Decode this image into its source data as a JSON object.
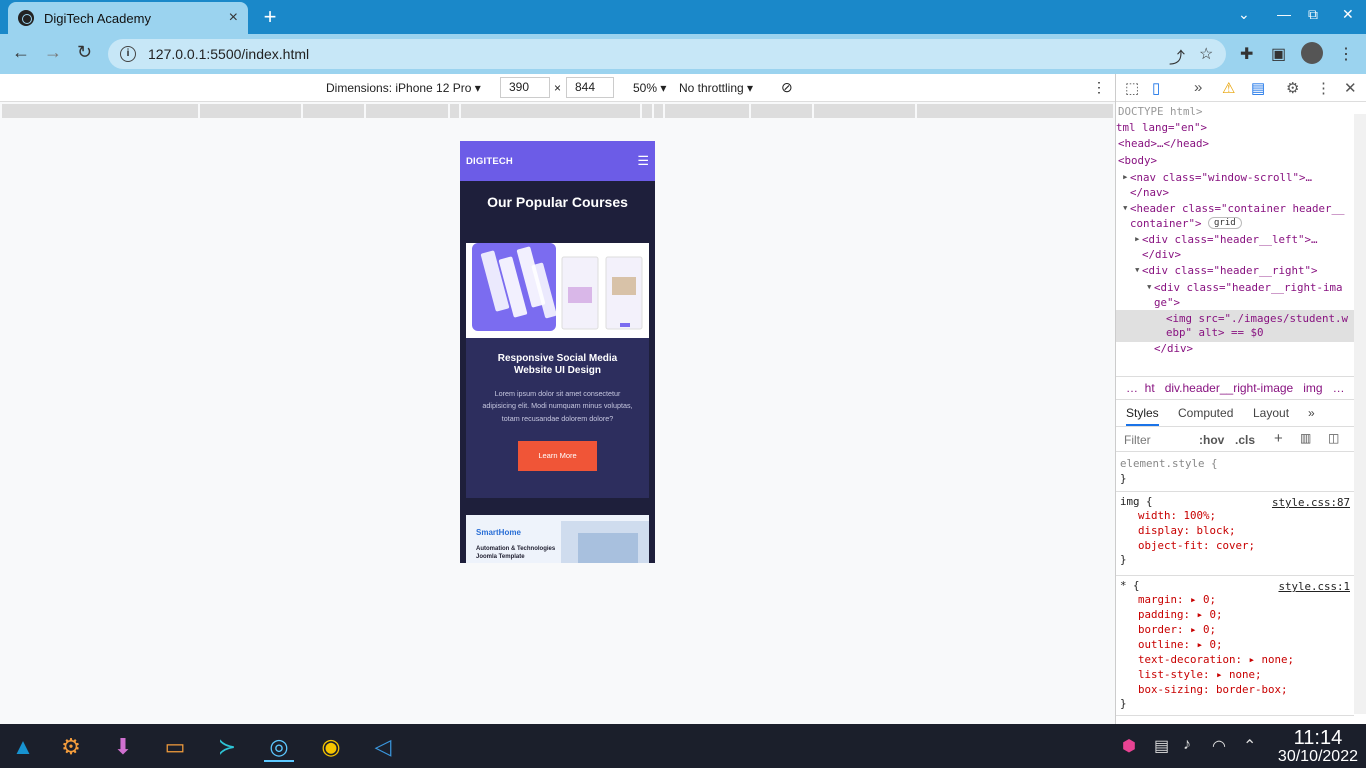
{
  "browser": {
    "tab_title": "DigiTech Academy",
    "url": "127.0.0.1:5500/index.html",
    "new_tab": "+",
    "close_tab": "×"
  },
  "device_toolbar": {
    "dimensions_label": "Dimensions: iPhone 12 Pro ▾",
    "width": "390",
    "times": "×",
    "height": "844",
    "zoom": "50% ▾",
    "throttling": "No throttling ▾"
  },
  "site": {
    "logo": "DIGITECH",
    "heading": "Our Popular Courses",
    "card1": {
      "title": "Responsive Social Media Website UI Design",
      "text": "Lorem ipsum dolor sit amet consectetur adipisicing elit. Modi numquam minus voluptas, totam recusandae dolorem dolore?",
      "button": "Learn More"
    },
    "card2": {
      "brand": "SmartHome",
      "subtitle": "Automation & Technologies Joomla Template"
    }
  },
  "devtools": {
    "elements": [
      "DOCTYPE html>",
      "tml lang=\"en\">",
      "<head>…</head>",
      "<body>",
      "<nav class=\"window-scroll\">…",
      "</nav>",
      "<header class=\"container header__",
      "container\">",
      "grid",
      "<div class=\"header__left\">…",
      "</div>",
      "<div class=\"header__right\">",
      "<div class=\"header__right-ima",
      "ge\">",
      "<img src=\"./images/student.w",
      "ebp\" alt> == $0",
      "</div>"
    ],
    "breadcrumbs": [
      "…",
      "ht",
      "div.header__right-image",
      "img",
      "…"
    ],
    "styles_tabs": [
      "Styles",
      "Computed",
      "Layout",
      "»"
    ],
    "filter_placeholder": "Filter",
    "hov": ":hov",
    "cls": ".cls",
    "rules": {
      "element_style": "element.style {",
      "close": "}",
      "img_selector": "img {",
      "img_source": "style.css:87",
      "img_props": [
        "width: 100%;",
        "display: block;",
        "object-fit: cover;"
      ],
      "star_selector": "* {",
      "star_source": "style.css:1",
      "star_props": [
        "margin: ▸ 0;",
        "padding: ▸ 0;",
        "border: ▸ 0;",
        "outline: ▸ 0;",
        "text-decoration: ▸ none;",
        "list-style: ▸ none;",
        "box-sizing: border-box;"
      ]
    }
  },
  "taskbar": {
    "time": "11:14",
    "date": "30/10/2022"
  }
}
